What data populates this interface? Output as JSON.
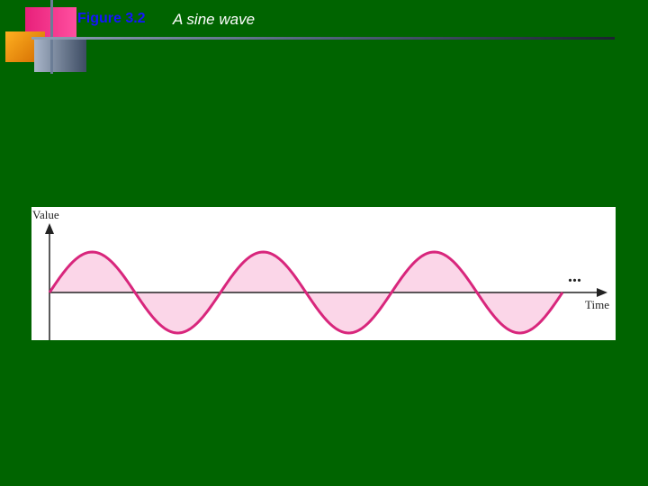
{
  "slide": {
    "figure_number": "Figure 3.2",
    "figure_title": "A sine wave"
  },
  "diagram": {
    "y_axis_label": "Value",
    "x_axis_label": "Time",
    "continuation": "...",
    "cycles": 3,
    "curve_color": "#d8267c",
    "fill_color": "#fbd6e8",
    "axis_color": "#222222"
  }
}
